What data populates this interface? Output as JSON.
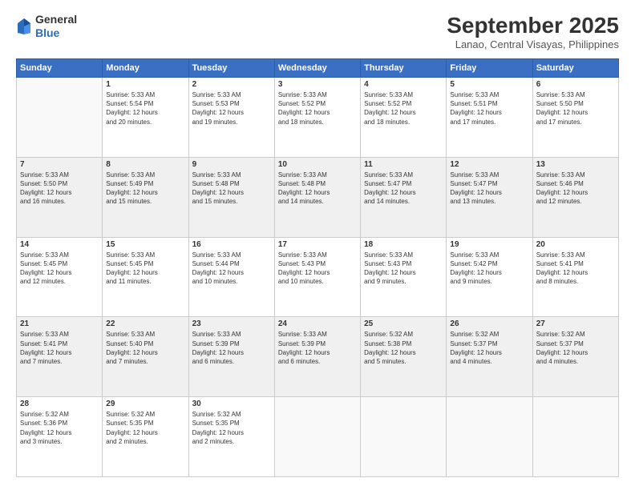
{
  "header": {
    "logo": {
      "line1": "General",
      "line2": "Blue"
    },
    "title": "September 2025",
    "subtitle": "Lanao, Central Visayas, Philippines"
  },
  "days_of_week": [
    "Sunday",
    "Monday",
    "Tuesday",
    "Wednesday",
    "Thursday",
    "Friday",
    "Saturday"
  ],
  "weeks": [
    [
      {
        "day": "",
        "info": ""
      },
      {
        "day": "1",
        "info": "Sunrise: 5:33 AM\nSunset: 5:54 PM\nDaylight: 12 hours\nand 20 minutes."
      },
      {
        "day": "2",
        "info": "Sunrise: 5:33 AM\nSunset: 5:53 PM\nDaylight: 12 hours\nand 19 minutes."
      },
      {
        "day": "3",
        "info": "Sunrise: 5:33 AM\nSunset: 5:52 PM\nDaylight: 12 hours\nand 18 minutes."
      },
      {
        "day": "4",
        "info": "Sunrise: 5:33 AM\nSunset: 5:52 PM\nDaylight: 12 hours\nand 18 minutes."
      },
      {
        "day": "5",
        "info": "Sunrise: 5:33 AM\nSunset: 5:51 PM\nDaylight: 12 hours\nand 17 minutes."
      },
      {
        "day": "6",
        "info": "Sunrise: 5:33 AM\nSunset: 5:50 PM\nDaylight: 12 hours\nand 17 minutes."
      }
    ],
    [
      {
        "day": "7",
        "info": "Sunrise: 5:33 AM\nSunset: 5:50 PM\nDaylight: 12 hours\nand 16 minutes."
      },
      {
        "day": "8",
        "info": "Sunrise: 5:33 AM\nSunset: 5:49 PM\nDaylight: 12 hours\nand 15 minutes."
      },
      {
        "day": "9",
        "info": "Sunrise: 5:33 AM\nSunset: 5:48 PM\nDaylight: 12 hours\nand 15 minutes."
      },
      {
        "day": "10",
        "info": "Sunrise: 5:33 AM\nSunset: 5:48 PM\nDaylight: 12 hours\nand 14 minutes."
      },
      {
        "day": "11",
        "info": "Sunrise: 5:33 AM\nSunset: 5:47 PM\nDaylight: 12 hours\nand 14 minutes."
      },
      {
        "day": "12",
        "info": "Sunrise: 5:33 AM\nSunset: 5:47 PM\nDaylight: 12 hours\nand 13 minutes."
      },
      {
        "day": "13",
        "info": "Sunrise: 5:33 AM\nSunset: 5:46 PM\nDaylight: 12 hours\nand 12 minutes."
      }
    ],
    [
      {
        "day": "14",
        "info": "Sunrise: 5:33 AM\nSunset: 5:45 PM\nDaylight: 12 hours\nand 12 minutes."
      },
      {
        "day": "15",
        "info": "Sunrise: 5:33 AM\nSunset: 5:45 PM\nDaylight: 12 hours\nand 11 minutes."
      },
      {
        "day": "16",
        "info": "Sunrise: 5:33 AM\nSunset: 5:44 PM\nDaylight: 12 hours\nand 10 minutes."
      },
      {
        "day": "17",
        "info": "Sunrise: 5:33 AM\nSunset: 5:43 PM\nDaylight: 12 hours\nand 10 minutes."
      },
      {
        "day": "18",
        "info": "Sunrise: 5:33 AM\nSunset: 5:43 PM\nDaylight: 12 hours\nand 9 minutes."
      },
      {
        "day": "19",
        "info": "Sunrise: 5:33 AM\nSunset: 5:42 PM\nDaylight: 12 hours\nand 9 minutes."
      },
      {
        "day": "20",
        "info": "Sunrise: 5:33 AM\nSunset: 5:41 PM\nDaylight: 12 hours\nand 8 minutes."
      }
    ],
    [
      {
        "day": "21",
        "info": "Sunrise: 5:33 AM\nSunset: 5:41 PM\nDaylight: 12 hours\nand 7 minutes."
      },
      {
        "day": "22",
        "info": "Sunrise: 5:33 AM\nSunset: 5:40 PM\nDaylight: 12 hours\nand 7 minutes."
      },
      {
        "day": "23",
        "info": "Sunrise: 5:33 AM\nSunset: 5:39 PM\nDaylight: 12 hours\nand 6 minutes."
      },
      {
        "day": "24",
        "info": "Sunrise: 5:33 AM\nSunset: 5:39 PM\nDaylight: 12 hours\nand 6 minutes."
      },
      {
        "day": "25",
        "info": "Sunrise: 5:32 AM\nSunset: 5:38 PM\nDaylight: 12 hours\nand 5 minutes."
      },
      {
        "day": "26",
        "info": "Sunrise: 5:32 AM\nSunset: 5:37 PM\nDaylight: 12 hours\nand 4 minutes."
      },
      {
        "day": "27",
        "info": "Sunrise: 5:32 AM\nSunset: 5:37 PM\nDaylight: 12 hours\nand 4 minutes."
      }
    ],
    [
      {
        "day": "28",
        "info": "Sunrise: 5:32 AM\nSunset: 5:36 PM\nDaylight: 12 hours\nand 3 minutes."
      },
      {
        "day": "29",
        "info": "Sunrise: 5:32 AM\nSunset: 5:35 PM\nDaylight: 12 hours\nand 2 minutes."
      },
      {
        "day": "30",
        "info": "Sunrise: 5:32 AM\nSunset: 5:35 PM\nDaylight: 12 hours\nand 2 minutes."
      },
      {
        "day": "",
        "info": ""
      },
      {
        "day": "",
        "info": ""
      },
      {
        "day": "",
        "info": ""
      },
      {
        "day": "",
        "info": ""
      }
    ]
  ]
}
